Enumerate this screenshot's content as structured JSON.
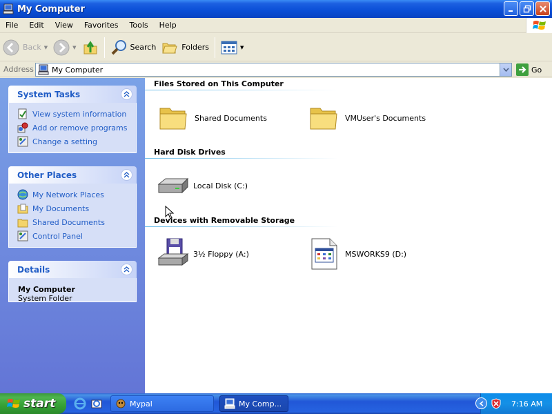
{
  "window": {
    "title": "My Computer"
  },
  "menu": [
    "File",
    "Edit",
    "View",
    "Favorites",
    "Tools",
    "Help"
  ],
  "toolbar": {
    "back": "Back",
    "search": "Search",
    "folders": "Folders"
  },
  "address": {
    "label": "Address",
    "value": "My Computer",
    "go": "Go"
  },
  "system_tasks": {
    "title": "System Tasks",
    "items": [
      "View system information",
      "Add or remove programs",
      "Change a setting"
    ]
  },
  "other_places": {
    "title": "Other Places",
    "items": [
      "My Network Places",
      "My Documents",
      "Shared Documents",
      "Control Panel"
    ]
  },
  "details": {
    "title": "Details",
    "name": "My Computer",
    "type": "System Folder"
  },
  "groups": [
    {
      "title": "Files Stored on This Computer",
      "items": [
        "Shared Documents",
        "VMUser's Documents"
      ]
    },
    {
      "title": "Hard Disk Drives",
      "items": [
        "Local Disk (C:)"
      ]
    },
    {
      "title": "Devices with Removable Storage",
      "items": [
        "3½ Floppy (A:)",
        "MSWORKS9 (D:)"
      ]
    }
  ],
  "taskbar": {
    "start": "start",
    "buttons": [
      "Mypal",
      "My Comp..."
    ],
    "clock": "7:16 AM"
  }
}
